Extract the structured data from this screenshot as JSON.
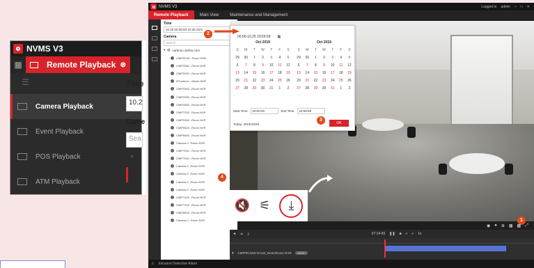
{
  "zoom": {
    "app_title": "NVMS V3",
    "active_tab": "Remote Playback",
    "nav_items": [
      {
        "label": "Camera Playback",
        "active": true
      },
      {
        "label": "Event Playback",
        "active": false
      },
      {
        "label": "POS Playback",
        "active": false
      },
      {
        "label": "ATM Playback",
        "active": false
      }
    ],
    "time_label": "Time",
    "time_value": "10.2",
    "camera_label": "Came",
    "search_placeholder": "Sea"
  },
  "app": {
    "title": "NVMS V3",
    "tabs": [
      "Remote Playback",
      "Main View",
      "Maintenance and Management"
    ],
    "titlebar_right": [
      "Logged in",
      "admin"
    ],
    "panel": {
      "time_label": "Time",
      "time_value": "10.25 00:00:00-10.25 23:5",
      "camera_label": "Camera",
      "search_placeholder": "Search",
      "tree_root": "carbono.dvrbio.com",
      "cameras": [
        "CMIP9C60...Room NVR",
        "CMIP3382...Room NVR",
        "CMIP2052...Room NVR",
        "IPCamera...offoom NVR",
        "CMIP2352...Room NVR",
        "CMIP2053...Room NVR",
        "CMIP2652...Room NVR",
        "CMIP7333...Room NVR",
        "CMIP5352...Room NVR",
        "CMIP8622...Room NVR",
        "CMIP8640...Room NVR",
        "Camera 0...Room NVR",
        "CMIP7041...Room NVR",
        "CMIP7042...Room NVR",
        "Camera 0...Room NVR",
        "Camera 0...Room NVR",
        "Camera 0...Room NVR",
        "Camera 0...Room NVR",
        "CMIP7422...Room NVR",
        "CMIP7422...Room NVR",
        "CMIP8643...Room NVR",
        "Camera 0...Room NVR"
      ]
    },
    "calendar": {
      "range_value": "00:00-10.25 23:59:59",
      "months": [
        "Oct 2019",
        "Oct 2019"
      ],
      "day_names": [
        "S",
        "M",
        "T",
        "W",
        "T",
        "F",
        "S"
      ],
      "start_time_label": "Start Time",
      "start_time": "00:00:00",
      "end_time_label": "End Time",
      "end_time": "23:59:59",
      "today": "Today: 2019/10/25",
      "ok_label": "OK"
    },
    "badges": [
      "1",
      "2",
      "3",
      "4"
    ],
    "playback_time": "07:14:49",
    "timeline_camera": "CMIP9C42W-M test_DemoRoom NVR",
    "timeline_pill": "10:21",
    "status_text": "Intrusion Detection Alarm"
  }
}
